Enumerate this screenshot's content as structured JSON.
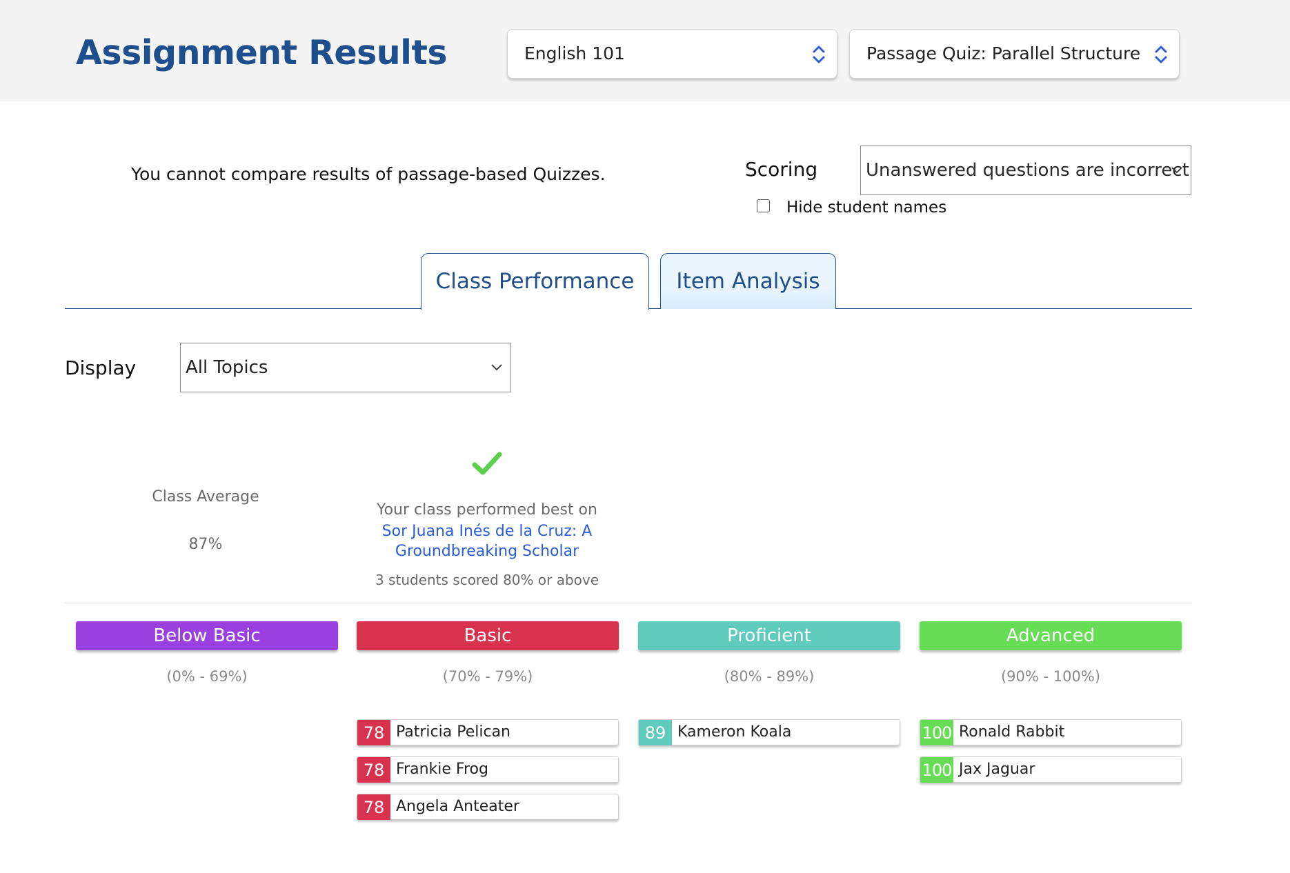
{
  "header": {
    "title": "Assignment Results",
    "course_select": "English 101",
    "quiz_select": "Passage Quiz: Parallel Structure"
  },
  "options": {
    "notice": "You cannot compare results of passage-based Quizzes.",
    "scoring_label": "Scoring",
    "scoring_value": "Unanswered questions are incorrect",
    "hide_names_label": "Hide student names",
    "hide_names_checked": false
  },
  "tabs": [
    {
      "label": "Class Performance",
      "active": true
    },
    {
      "label": "Item Analysis",
      "active": false
    }
  ],
  "display": {
    "label": "Display",
    "value": "All Topics"
  },
  "summary": {
    "class_average_label": "Class Average",
    "class_average_value": "87%",
    "best_text": "Your class performed best on",
    "best_topic": "Sor Juana Inés de la Cruz: A Groundbreaking Scholar",
    "best_count": "3 students scored 80% or above"
  },
  "bands": [
    {
      "label": "Below Basic",
      "range": "(0% - 69%)",
      "color": "#9b40e0",
      "students": []
    },
    {
      "label": "Basic",
      "range": "(70% - 79%)",
      "color": "#d8324e",
      "students": [
        {
          "score": "78",
          "name": "Patricia Pelican"
        },
        {
          "score": "78",
          "name": "Frankie Frog"
        },
        {
          "score": "78",
          "name": "Angela Anteater"
        }
      ]
    },
    {
      "label": "Proficient",
      "range": "(80% - 89%)",
      "color": "#5ecbbd",
      "students": [
        {
          "score": "89",
          "name": "Kameron Koala"
        }
      ]
    },
    {
      "label": "Advanced",
      "range": "(90% - 100%)",
      "color": "#66dd55",
      "students": [
        {
          "score": "100",
          "name": "Ronald Rabbit"
        },
        {
          "score": "100",
          "name": "Jax Jaguar"
        }
      ]
    }
  ],
  "colors": {
    "title": "#1f4e8c",
    "link": "#2a5ed8",
    "check": "#5ccf4f"
  },
  "icons": {
    "select_arrows": "chevron-up-down-icon",
    "dropdown": "chevron-down-icon",
    "success": "checkmark-icon"
  }
}
